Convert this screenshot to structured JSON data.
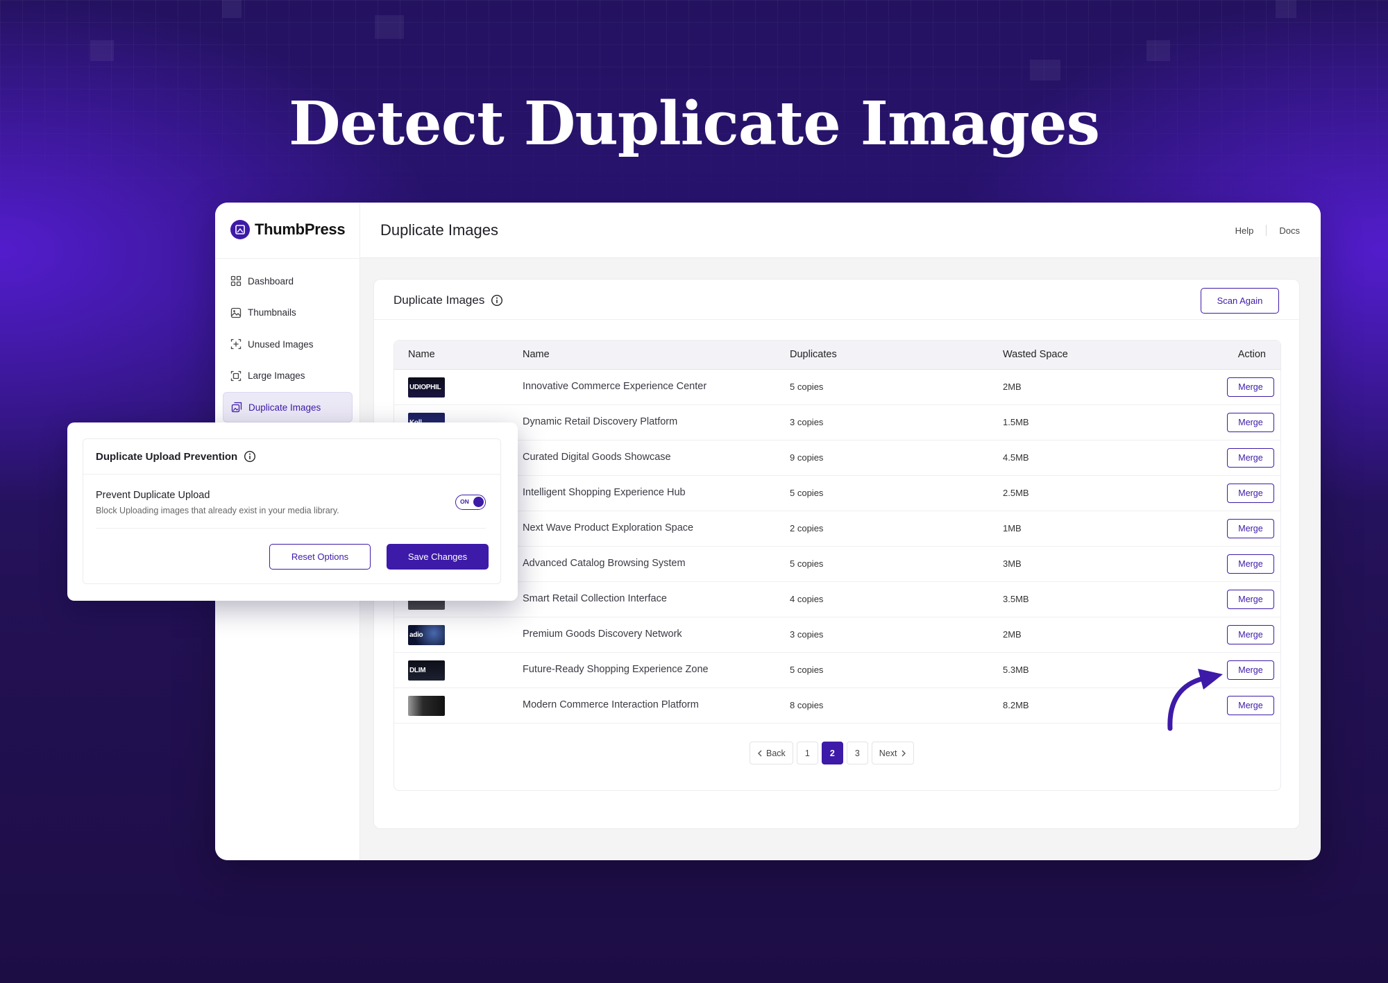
{
  "hero": {
    "title": "Detect Duplicate Images"
  },
  "brand": {
    "name": "ThumbPress",
    "accent": "#3d1aa8"
  },
  "sidebar": {
    "items": [
      {
        "label": "Dashboard",
        "icon": "dashboard-icon"
      },
      {
        "label": "Thumbnails",
        "icon": "thumbnails-icon"
      },
      {
        "label": "Unused Images",
        "icon": "unused-images-icon"
      },
      {
        "label": "Large Images",
        "icon": "large-images-icon"
      },
      {
        "label": "Duplicate Images",
        "icon": "duplicate-images-icon",
        "active": true
      }
    ]
  },
  "header": {
    "title": "Duplicate Images",
    "help": "Help",
    "docs": "Docs"
  },
  "panel": {
    "title": "Duplicate Images",
    "scan_again": "Scan Again"
  },
  "table": {
    "columns": [
      "Name",
      "Name",
      "Duplicates",
      "Wasted Space",
      "Action"
    ],
    "rows": [
      {
        "thumb_text": "UDIOPHIL",
        "name": "Innovative Commerce Experience Center",
        "duplicates": "5 copies",
        "wasted": "2MB",
        "action": "Merge"
      },
      {
        "thumb_text": "Koll",
        "name": "Dynamic Retail Discovery Platform",
        "duplicates": "3 copies",
        "wasted": "1.5MB",
        "action": "Merge"
      },
      {
        "thumb_text": "",
        "name": "Curated Digital Goods Showcase",
        "duplicates": "9 copies",
        "wasted": "4.5MB",
        "action": "Merge"
      },
      {
        "thumb_text": "",
        "name": "Intelligent Shopping Experience Hub",
        "duplicates": "5 copies",
        "wasted": "2.5MB",
        "action": "Merge"
      },
      {
        "thumb_text": "",
        "name": "Next Wave Product Exploration Space",
        "duplicates": "2 copies",
        "wasted": "1MB",
        "action": "Merge"
      },
      {
        "thumb_text": "",
        "name": "Advanced Catalog Browsing System",
        "duplicates": "5 copies",
        "wasted": "3MB",
        "action": "Merge"
      },
      {
        "thumb_text": "",
        "name": "Smart Retail Collection Interface",
        "duplicates": "4 copies",
        "wasted": "3.5MB",
        "action": "Merge"
      },
      {
        "thumb_text": "adio",
        "name": "Premium Goods Discovery Network",
        "duplicates": "3 copies",
        "wasted": "2MB",
        "action": "Merge"
      },
      {
        "thumb_text": "DLIM",
        "name": "Future-Ready Shopping Experience Zone",
        "duplicates": "5 copies",
        "wasted": "5.3MB",
        "action": "Merge"
      },
      {
        "thumb_text": "",
        "name": "Modern Commerce Interaction Platform",
        "duplicates": "8 copies",
        "wasted": "8.2MB",
        "action": "Merge"
      }
    ]
  },
  "pagination": {
    "back": "Back",
    "pages": [
      "1",
      "2",
      "3"
    ],
    "current": "2",
    "next": "Next"
  },
  "modal": {
    "title": "Duplicate Upload Prevention",
    "option_label": "Prevent Duplicate Upload",
    "option_desc": "Block Uploading images that already exist in your media library.",
    "toggle_text": "ON",
    "reset_label": "Reset Options",
    "save_label": "Save Changes"
  }
}
